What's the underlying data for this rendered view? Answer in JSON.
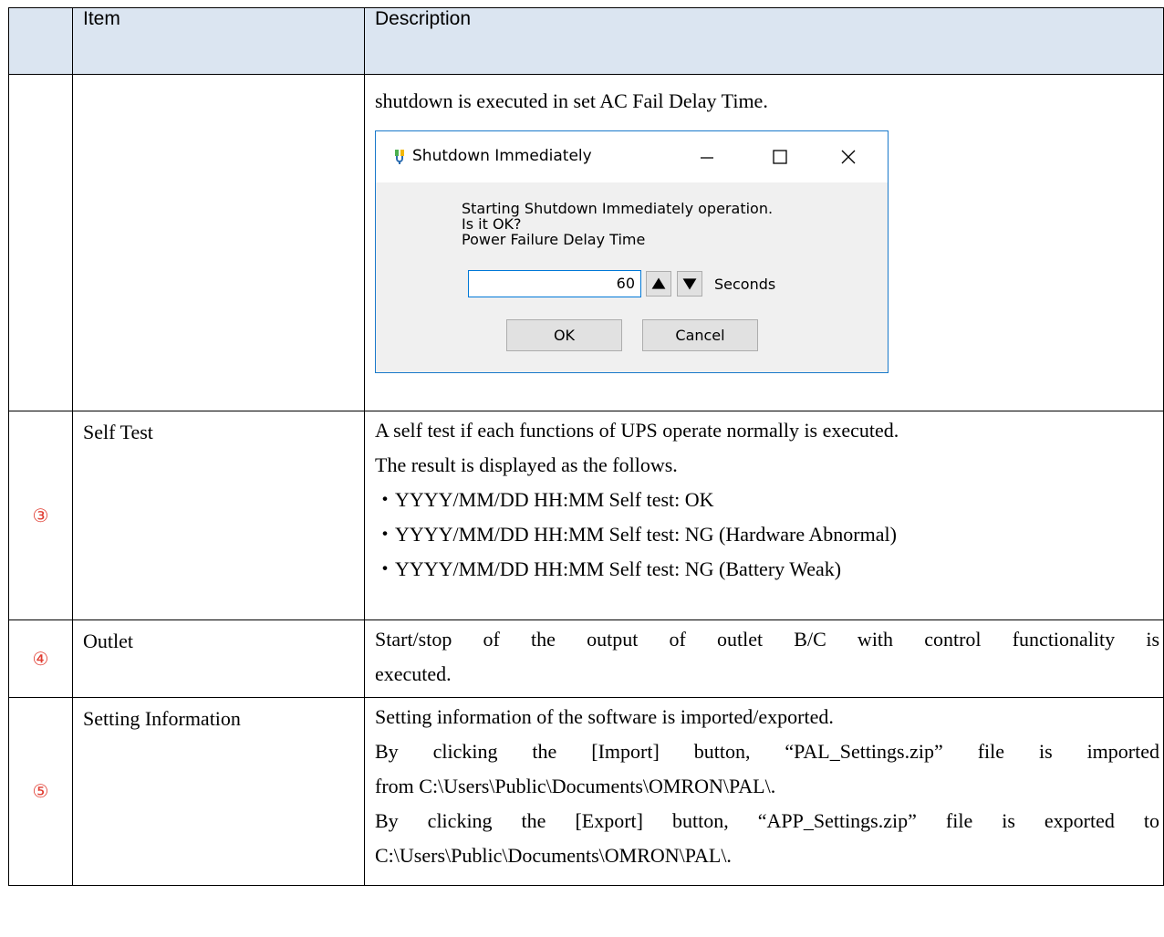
{
  "table": {
    "headers": {
      "num": "",
      "item": "Item",
      "description": "Description"
    },
    "continued_row": {
      "description": "shutdown is executed in set AC Fail Delay Time."
    },
    "rows": [
      {
        "num": "③",
        "item": "Self Test",
        "lines": [
          "A self test if each functions of UPS operate normally is executed.",
          "The result is displayed as the follows.",
          "・YYYY/MM/DD HH:MM Self test: OK",
          "・YYYY/MM/DD HH:MM Self test: NG (Hardware Abnormal)",
          "・YYYY/MM/DD HH:MM Self test: NG (Battery Weak)"
        ]
      },
      {
        "num": "④",
        "item": "Outlet",
        "lines": [
          "Start/stop of the output of outlet B/C with control functionality is",
          "executed."
        ]
      },
      {
        "num": "⑤",
        "item": "Setting Information",
        "lines": [
          "Setting information of the software is imported/exported.",
          "By clicking the [Import] button, “PAL_Settings.zip” file is imported",
          "from C:\\Users\\Public\\Documents\\OMRON\\PAL\\.",
          "By clicking the [Export] button, “APP_Settings.zip” file is exported to",
          "C:\\Users\\Public\\Documents\\OMRON\\PAL\\."
        ]
      }
    ]
  },
  "dialog": {
    "title": "Shutdown Immediately",
    "app_icon": "plug-icon",
    "message_line1": "Starting Shutdown Immediately operation.",
    "message_line2": "Is it OK?",
    "message_line3": "Power Failure Delay Time",
    "delay_value": "60",
    "unit_label": "Seconds",
    "ok_label": "OK",
    "cancel_label": "Cancel",
    "accent_color": "#1979ca"
  }
}
